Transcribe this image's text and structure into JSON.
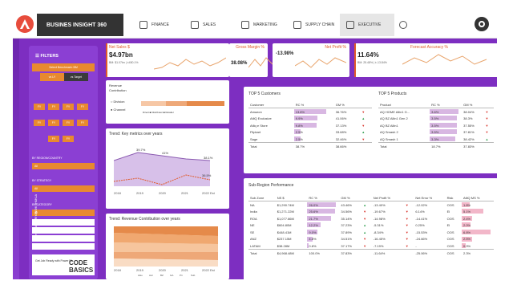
{
  "nav": {
    "brand": "BUSINES INSIGHT 360",
    "tabs": [
      "FINANCE",
      "SALES",
      "MARKETING",
      "SUPPLY CHAIN",
      "EXECUTIVE"
    ]
  },
  "sidebar": {
    "filters_label": "FILTERS",
    "benchmark_label": "Select Benchmark: BM",
    "benchmark_options": [
      "vs LY",
      "vs Target"
    ],
    "years": [
      "FY",
      "FY",
      "FY",
      "FY",
      "FY",
      "FY",
      "FY",
      "FY",
      "FY",
      "FY"
    ],
    "region_label": "BY REGION/COUNTRY",
    "region_value": "All",
    "strategy_label": "BY STRATEGY",
    "strategy_value": "All",
    "category_label": "BY CATEGORY",
    "category_value": "All",
    "designed_by": "Designed by PRIYANSHI SHUKLA",
    "job_text": "Get Job Ready with Power BI",
    "code_logo": "CODE BASICS"
  },
  "kpis": [
    {
      "title": "Net Sales $",
      "value": "$4.97bn",
      "sub": "BM: $1.07bn | ±450.1%"
    },
    {
      "title": "Gross Margin %",
      "value": "38.08%",
      "sub": "BM: 37.56% | ±0.52%"
    },
    {
      "title": "Net Profit %",
      "value": "-13.98%",
      "sub": "BM: -13.45% | ±0.53%"
    },
    {
      "title": "Forecast Accuracy %",
      "value": "11.64%",
      "sub": "BM: 25.48% | ±-13.84%"
    }
  ],
  "revenue_contribution": {
    "title": "Revenue Contribution",
    "options": [
      "Division",
      "Channel"
    ],
    "legend": [
      "Direct",
      "Distributor",
      "Retailer"
    ]
  },
  "trend_key": {
    "title": "Trend: Key metrics over years",
    "years": [
      "2018",
      "2019",
      "2020",
      "2021",
      "2022 Est"
    ],
    "labels": [
      "39.7%",
      "41%",
      "38.1%",
      "36.5%"
    ]
  },
  "trend_rev": {
    "title": "Trend: Revenue Contribution over years",
    "years": [
      "2018",
      "2019",
      "2020",
      "2021",
      "2022 Est"
    ],
    "legend": [
      "AHo",
      "Acc",
      "BZ",
      "GA",
      "Pri",
      "Sub"
    ]
  },
  "top_customers": {
    "title": "TOP 5 Customers",
    "headers": [
      "Customer",
      "RC %",
      "GM %"
    ],
    "rows": [
      {
        "name": "Amazon",
        "rc": "13.8%",
        "gm": "36.76%",
        "dir": "down",
        "w": 100
      },
      {
        "name": "AtliQ Exclusive",
        "rc": "9.9%",
        "gm": "41.06%",
        "dir": "up",
        "w": 72
      },
      {
        "name": "Atliq e Store",
        "rc": "9.8%",
        "gm": "37.13%",
        "dir": "down",
        "w": 71
      },
      {
        "name": "Flipkart",
        "rc": "2.5%",
        "gm": "33.68%",
        "dir": "up",
        "w": 20
      },
      {
        "name": "Sage",
        "rc": "2.5%",
        "gm": "32.46%",
        "dir": "down",
        "w": 19
      }
    ],
    "total": {
      "name": "Total",
      "rc": "38.7%",
      "gm": "38.66%"
    }
  },
  "top_products": {
    "title": "TOP 5 Products",
    "headers": [
      "Product",
      "RC %",
      "GM %"
    ],
    "rows": [
      {
        "name": "AQ HOME Allin1 G...",
        "rc": "3.6%",
        "gm": "38.04%",
        "dir": "down",
        "w": 100
      },
      {
        "name": "AQ BZ Allin1 Gen 2",
        "rc": "3.5%",
        "gm": "38.3%",
        "dir": "down",
        "w": 96
      },
      {
        "name": "AQ BZ Allin1",
        "rc": "3.5%",
        "gm": "37.55%",
        "dir": "down",
        "w": 96
      },
      {
        "name": "AQ Smash 2",
        "rc": "3.5%",
        "gm": "37.81%",
        "dir": "down",
        "w": 95
      },
      {
        "name": "AQ Smash 1",
        "rc": "3.3%",
        "gm": "38.42%",
        "dir": "up",
        "w": 90
      }
    ],
    "total": {
      "name": "Total",
      "rc": "18.7%",
      "gm": "37.83%"
    }
  },
  "subregion": {
    "title": "Sub-Region Performance",
    "headers": [
      "Sub Zone",
      "NS $",
      "RC %",
      "GM %",
      "Net Profit %",
      "Net Error %",
      "Risk",
      "AtliQ MS %"
    ],
    "rows": [
      {
        "zone": "NA",
        "ns": "$1,290.74M",
        "rc": "26.0%",
        "gm": "43.46%",
        "gmdir": "up",
        "np": "-13.40%",
        "npdir": "down",
        "ne": "-12.02%",
        "risk": "OOS",
        "ms": "1.8%",
        "rcw": 100,
        "msw": 26
      },
      {
        "zone": "India",
        "ns": "$1,271.22M",
        "rc": "25.6%",
        "gm": "34.56%",
        "gmdir": "down",
        "np": "-19.67%",
        "npdir": "down",
        "ne": "6.14%",
        "risk": "EI",
        "ms": "5.1%",
        "rcw": 98,
        "msw": 74
      },
      {
        "zone": "ROA",
        "ns": "$1,077.86M",
        "rc": "21.7%",
        "gm": "35.14%",
        "gmdir": "down",
        "np": "-14.98%",
        "npdir": "down",
        "ne": "-14.41%",
        "risk": "OOS",
        "ms": "2.4%",
        "rcw": 83,
        "msw": 35
      },
      {
        "zone": "NE",
        "ns": "$604.80M",
        "rc": "12.2%",
        "gm": "37.23%",
        "gmdir": "up",
        "np": "-5.31%",
        "npdir": "down",
        "ne": "0.25%",
        "risk": "EI",
        "ms": "2.0%",
        "rcw": 47,
        "msw": 29
      },
      {
        "zone": "SE",
        "ns": "$448.41M",
        "rc": "9.0%",
        "gm": "37.89%",
        "gmdir": "up",
        "np": "-8.34%",
        "npdir": "down",
        "ne": "-15.53%",
        "risk": "OOS",
        "ms": "6.8%",
        "rcw": 35,
        "msw": 100
      },
      {
        "zone": "ANZ",
        "ns": "$237.15M",
        "rc": "4.8%",
        "gm": "34.51%",
        "gmdir": "down",
        "np": "-16.45%",
        "npdir": "down",
        "ne": "-24.66%",
        "risk": "OOS",
        "ms": "2.5%",
        "rcw": 18,
        "msw": 36
      },
      {
        "zone": "LATAM",
        "ns": "$38.28M",
        "rc": "0.8%",
        "gm": "37.17%",
        "gmdir": "down",
        "np": "-7.19%",
        "npdir": "down",
        "ne": "-",
        "risk": "OOS",
        "ms": "0.9%",
        "rcw": 4,
        "msw": 13
      }
    ],
    "total": {
      "zone": "Total",
      "ns": "$4,968.48M",
      "rc": "100.0%",
      "gm": "37.83%",
      "np": "-11.64%",
      "ne": "-25.06%",
      "risk": "OOS",
      "ms": "2.3%"
    }
  },
  "colors": {
    "accent": "#e05a2a",
    "purple": "#7d2ec1",
    "orange": "#e8892f"
  }
}
